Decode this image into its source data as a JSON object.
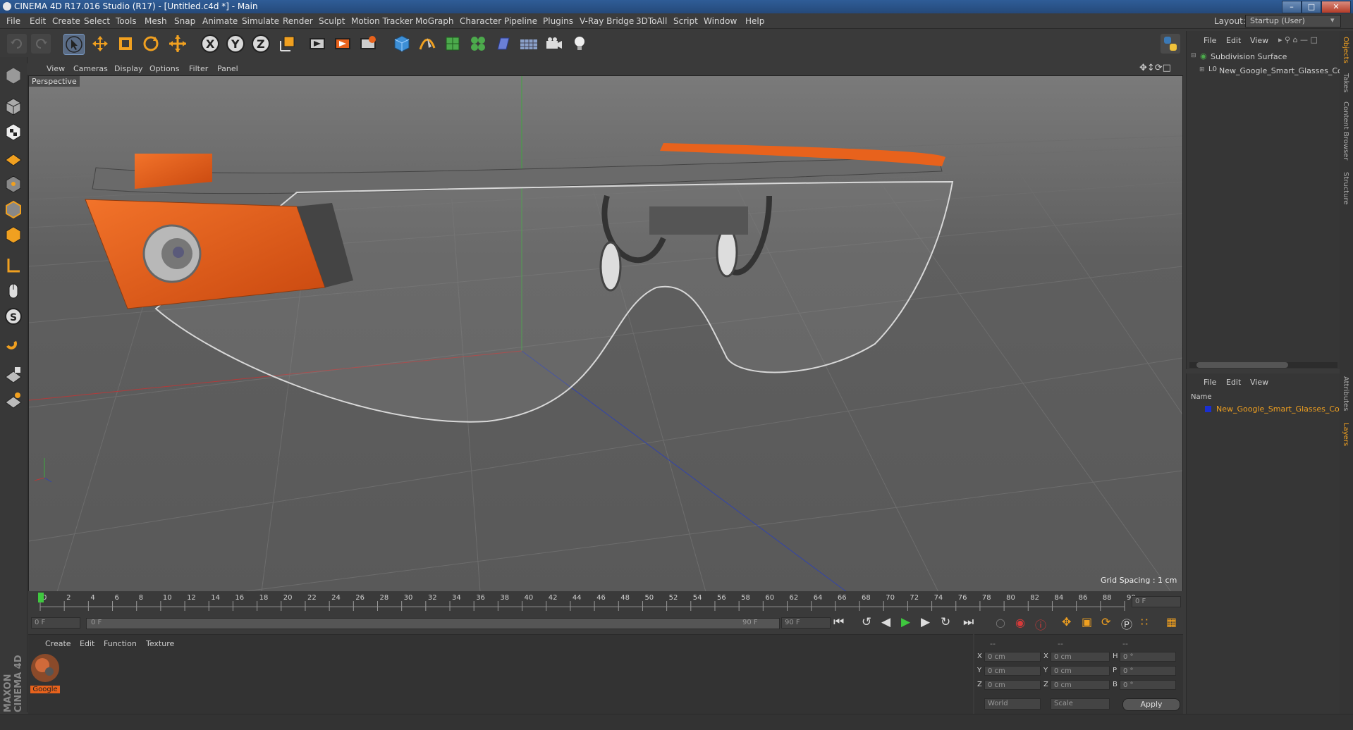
{
  "window": {
    "title": "CINEMA 4D R17.016 Studio (R17) - [Untitled.c4d *] - Main",
    "controls": [
      "minimize",
      "maximize",
      "close"
    ]
  },
  "menubar": {
    "items": [
      "File",
      "Edit",
      "Create",
      "Select",
      "Tools",
      "Mesh",
      "Snap",
      "Animate",
      "Simulate",
      "Render",
      "Sculpt",
      "Motion Tracker",
      "MoGraph",
      "Character",
      "Pipeline",
      "Plugins",
      "V-Ray Bridge",
      "3DToAll",
      "Script",
      "Window",
      "Help"
    ],
    "layout_label": "Layout:",
    "layout_value": "Startup (User)"
  },
  "toolbar": {
    "icons": [
      "undo-icon",
      "redo-icon",
      "select-arrow-icon",
      "move-icon",
      "scale-icon",
      "rotate-icon",
      "transform-icon",
      "x-axis-icon",
      "y-axis-icon",
      "z-axis-icon",
      "coordinate-system-icon",
      "render-view-icon",
      "render-picture-viewer-icon",
      "render-settings-icon",
      "cube-primitive-icon",
      "pen-spline-icon",
      "subdivision-icon",
      "cloner-icon",
      "deformer-icon",
      "floor-icon",
      "camera-icon",
      "light-icon"
    ],
    "xyz": [
      "X",
      "Y",
      "Z"
    ]
  },
  "viewport": {
    "menu": [
      "View",
      "Cameras",
      "Display",
      "Options",
      "Filter",
      "Panel"
    ],
    "label": "Perspective",
    "grid_spacing": "Grid Spacing : 1 cm"
  },
  "timeline": {
    "ticks": [
      "0",
      "2",
      "4",
      "6",
      "8",
      "10",
      "12",
      "14",
      "16",
      "18",
      "20",
      "22",
      "24",
      "26",
      "28",
      "30",
      "32",
      "34",
      "36",
      "38",
      "40",
      "42",
      "44",
      "46",
      "48",
      "50",
      "52",
      "54",
      "56",
      "58",
      "60",
      "62",
      "64",
      "66",
      "68",
      "70",
      "72",
      "74",
      "76",
      "78",
      "80",
      "82",
      "84",
      "86",
      "88",
      "90"
    ],
    "current_frame": "0 F",
    "start_field": "0 F",
    "range_start": "0 F",
    "range_end": "90 F",
    "end_field": "90 F"
  },
  "material_manager": {
    "menu": [
      "Create",
      "Edit",
      "Function",
      "Texture"
    ],
    "material_name": "Google"
  },
  "coordinates": {
    "headers": [
      "--",
      "--",
      "--"
    ],
    "rows": [
      {
        "axis": "X",
        "pos": "0 cm",
        "axis2": "X",
        "size": "0 cm",
        "rot_label": "H",
        "rot": "0 °"
      },
      {
        "axis": "Y",
        "pos": "0 cm",
        "axis2": "Y",
        "size": "0 cm",
        "rot_label": "P",
        "rot": "0 °"
      },
      {
        "axis": "Z",
        "pos": "0 cm",
        "axis2": "Z",
        "size": "0 cm",
        "rot_label": "B",
        "rot": "0 °"
      }
    ],
    "mode1": "World",
    "mode2": "Scale",
    "apply": "Apply"
  },
  "object_manager": {
    "menu": [
      "File",
      "Edit",
      "View"
    ],
    "objects": [
      "Subdivision Surface",
      "New_Google_Smart_Glasses_Cor"
    ]
  },
  "layer_manager": {
    "menu": [
      "File",
      "Edit",
      "View"
    ],
    "column_header": "Name",
    "layers": [
      "New_Google_Smart_Glasses_Cora"
    ]
  },
  "right_tabs": [
    "Objects",
    "Takes",
    "Content Browser",
    "Structure",
    "Attributes",
    "Layers"
  ],
  "branding": "MAXON CINEMA 4D",
  "colors": {
    "accent_orange": "#e8621c",
    "viewport_bg": "#5e5e5e",
    "layer_color": "#1a2fd0"
  }
}
